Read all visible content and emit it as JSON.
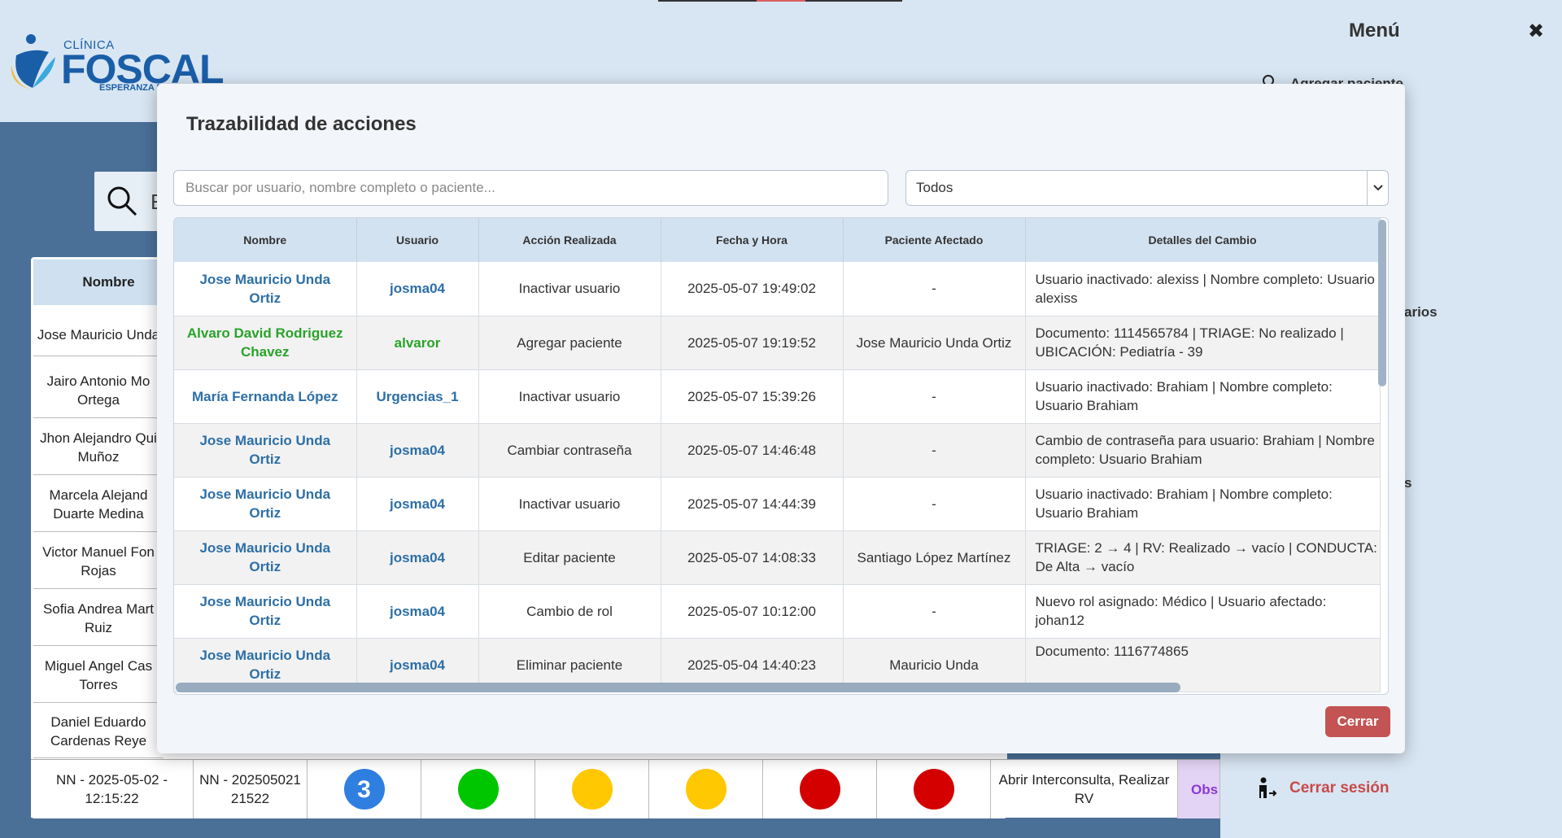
{
  "brand": {
    "clinica": "CLÍNICA",
    "name": "FOSCAL",
    "tagline": "ESPERANZA D"
  },
  "search_fragment": "E",
  "background_table": {
    "header": "Nombre",
    "names": [
      "Jose Mauricio Unda",
      "Jairo Antonio Mo Ortega",
      "Jhon Alejandro Qui Muñoz",
      "Marcela Alejand Duarte Medina",
      "Victor Manuel Fon Rojas",
      "Sofia Andrea Mart Ruiz",
      "Miguel Angel Cas Torres",
      "Daniel Eduardo Cardenas Reye"
    ],
    "last_row": {
      "name": "NN - 2025-05-02 - 12:15:22",
      "doc": "NN - 20250502121522",
      "triage": "3",
      "action": "Abrir Interconsulta, Realizar RV",
      "obs": "Obs"
    }
  },
  "menu": {
    "title": "Menú",
    "close": "✖",
    "item1": "Agregar paciente",
    "frag2": "e",
    "frag3": "arios",
    "frag4": "s",
    "logout": "Cerrar sesión"
  },
  "modal": {
    "title": "Trazabilidad de acciones",
    "search_placeholder": "Buscar por usuario, nombre completo o paciente...",
    "filter_value": "Todos",
    "columns": [
      "Nombre",
      "Usuario",
      "Acción Realizada",
      "Fecha y Hora",
      "Paciente Afectado",
      "Detalles del Cambio"
    ],
    "rows": [
      {
        "nombre": "Jose Mauricio Unda Ortiz",
        "usuario": "josma04",
        "accion": "Inactivar usuario",
        "fecha": "2025-05-07 19:49:02",
        "paciente": "-",
        "detalle": "Usuario inactivado: alexiss | Nombre completo: Usuario alexiss"
      },
      {
        "nombre": "Alvaro David Rodriguez Chavez",
        "usuario": "alvaror",
        "accion": "Agregar paciente",
        "fecha": "2025-05-07 19:19:52",
        "paciente": "Jose Mauricio Unda Ortiz",
        "detalle": "Documento: 1114565784 | TRIAGE: No realizado | UBICACIÓN: Pediatría - 39"
      },
      {
        "nombre": "María Fernanda López",
        "usuario": "Urgencias_1",
        "accion": "Inactivar usuario",
        "fecha": "2025-05-07 15:39:26",
        "paciente": "-",
        "detalle": "Usuario inactivado: Brahiam | Nombre completo: Usuario Brahiam"
      },
      {
        "nombre": "Jose Mauricio Unda Ortiz",
        "usuario": "josma04",
        "accion": "Cambiar contraseña",
        "fecha": "2025-05-07 14:46:48",
        "paciente": "-",
        "detalle": "Cambio de contraseña para usuario: Brahiam | Nombre completo: Usuario Brahiam"
      },
      {
        "nombre": "Jose Mauricio Unda Ortiz",
        "usuario": "josma04",
        "accion": "Inactivar usuario",
        "fecha": "2025-05-07 14:44:39",
        "paciente": "-",
        "detalle": "Usuario inactivado: Brahiam | Nombre completo: Usuario Brahiam"
      },
      {
        "nombre": "Jose Mauricio Unda Ortiz",
        "usuario": "josma04",
        "accion": "Editar paciente",
        "fecha": "2025-05-07 14:08:33",
        "paciente": "Santiago López Martínez",
        "detalle": "TRIAGE: 2 → 4 | RV: Realizado → vacío | CONDUCTA: De Alta → vacío"
      },
      {
        "nombre": "Jose Mauricio Unda Ortiz",
        "usuario": "josma04",
        "accion": "Cambio de rol",
        "fecha": "2025-05-07 10:12:00",
        "paciente": "-",
        "detalle": "Nuevo rol asignado: Médico | Usuario afectado: johan12"
      },
      {
        "nombre": "Jose Mauricio Unda Ortiz",
        "usuario": "josma04",
        "accion": "Eliminar paciente",
        "fecha": "2025-05-04 14:40:23",
        "paciente": "Mauricio Unda",
        "detalle": "Documento: 1116774865"
      }
    ],
    "close_button": "Cerrar"
  },
  "colors": {
    "green": "#00c600",
    "yellow": "#ffc800",
    "red": "#d40000",
    "blue": "#2f7fe0"
  }
}
